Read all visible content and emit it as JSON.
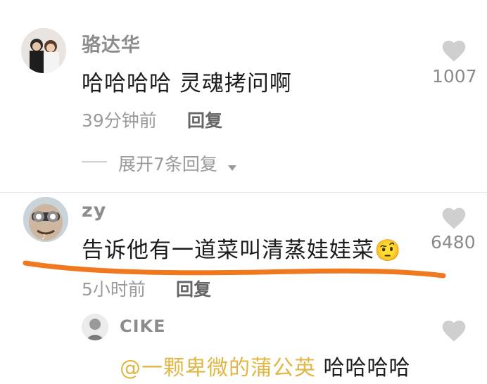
{
  "comments": [
    {
      "username": "骆达华",
      "text": "哈哈哈哈 灵魂拷问啊",
      "time": "39分钟前",
      "reply_label": "回复",
      "like_count": "1007",
      "expand_label": "展开7条回复"
    },
    {
      "username": "zy",
      "text": "告诉他有一道菜叫清蒸娃娃菜",
      "emoji": "🤨",
      "time": "5小时前",
      "reply_label": "回复",
      "like_count": "6480"
    }
  ],
  "reply": {
    "username": "CIKE",
    "mention": "@一颗卑微的蒲公英",
    "text": " 哈哈哈哈"
  },
  "colors": {
    "annotation_underline": "#f0781e",
    "mention": "#e0b645",
    "like_icon": "#cfcfcf"
  }
}
